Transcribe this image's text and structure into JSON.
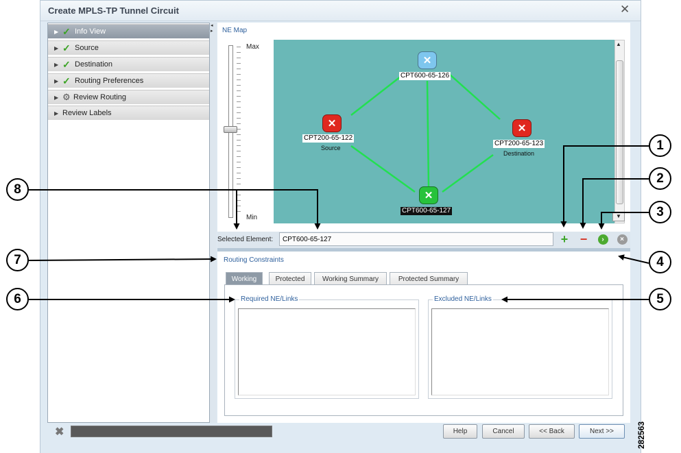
{
  "window": {
    "title": "Create MPLS-TP Tunnel Circuit",
    "close_glyph": "✕"
  },
  "nav": {
    "items": [
      {
        "label": "Info View",
        "state": "checked",
        "selected": true
      },
      {
        "label": "Source",
        "state": "checked"
      },
      {
        "label": "Destination",
        "state": "checked"
      },
      {
        "label": "Routing Preferences",
        "state": "checked"
      },
      {
        "label": "Review Routing",
        "state": "gear"
      },
      {
        "label": "Review Labels",
        "state": "none"
      }
    ]
  },
  "map": {
    "section_label": "NE Map",
    "zoom": {
      "max_label": "Max",
      "min_label": "Min",
      "level": 0.5
    },
    "nodes": [
      {
        "name": "CPT600-65-126",
        "color": "#7ec6ee",
        "sub": ""
      },
      {
        "name": "CPT200-65-122",
        "color": "#e02820",
        "sub": "Source"
      },
      {
        "name": "CPT200-65-123",
        "color": "#e02820",
        "sub": "Destination"
      },
      {
        "name": "CPT600-65-127",
        "color": "#27c23c",
        "sub": ""
      }
    ],
    "link_color": "#22e050",
    "background": "#6ab8b7"
  },
  "selected_element": {
    "label": "Selected Element:",
    "value": "CPT600-65-127"
  },
  "tools": {
    "add_glyph": "+",
    "remove_glyph": "−",
    "next_glyph": "›",
    "clear_glyph": "×"
  },
  "routing": {
    "title": "Routing Constraints",
    "tabs": [
      "Working",
      "Protected",
      "Working Summary",
      "Protected Summary"
    ],
    "active_tab": "Working",
    "required_title": "Required NE/Links",
    "excluded_title": "Excluded NE/Links"
  },
  "footer": {
    "help": "Help",
    "cancel": "Cancel",
    "back": "<< Back",
    "next": "Next >>",
    "close_glyph": "✖"
  },
  "callouts": [
    "1",
    "2",
    "3",
    "4",
    "5",
    "6",
    "7",
    "8"
  ],
  "figure_id": "282563"
}
